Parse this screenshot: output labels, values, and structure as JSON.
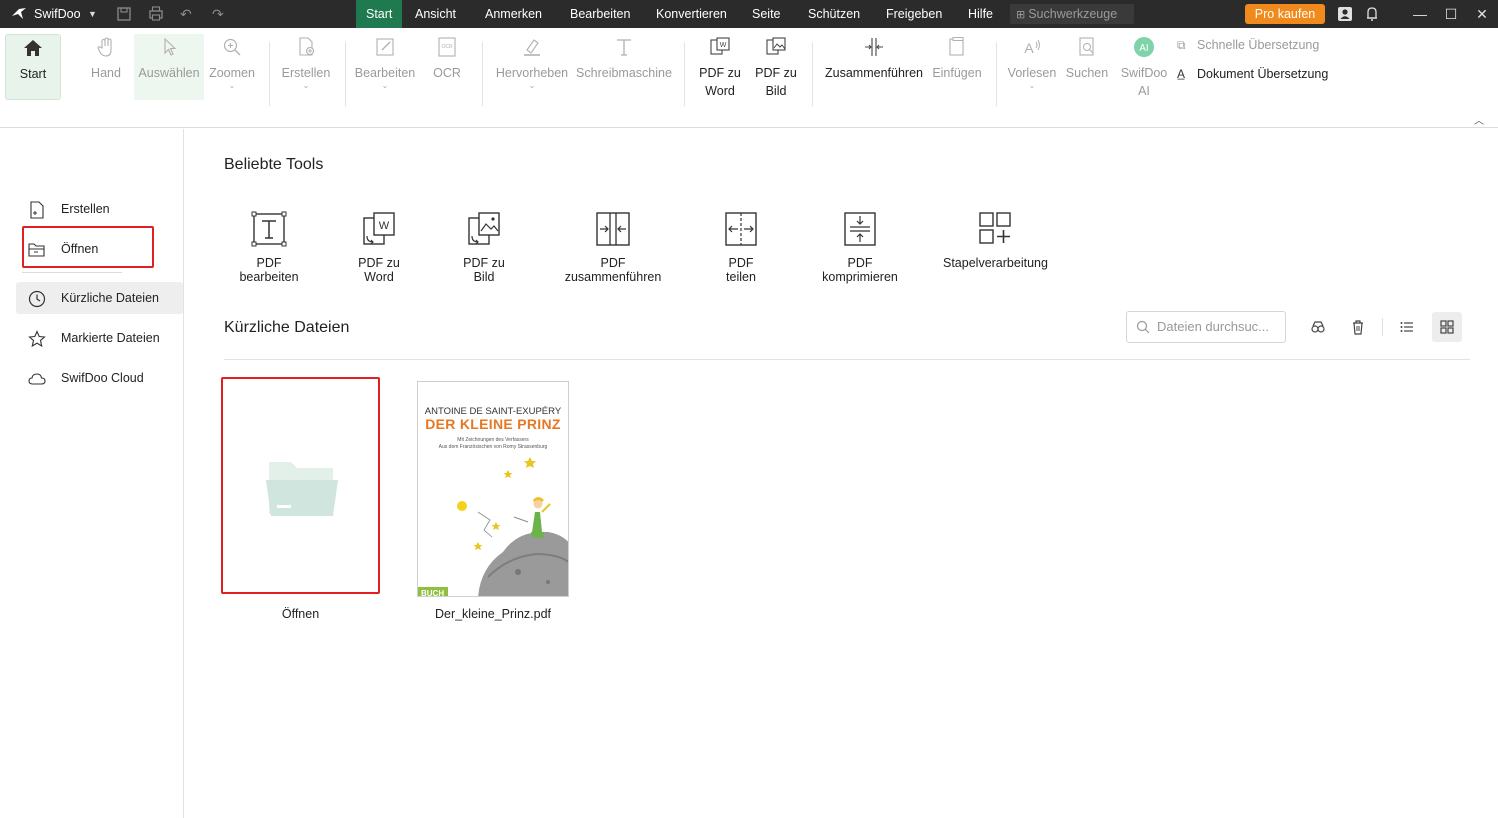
{
  "titlebar": {
    "app_name": "SwifDoo",
    "menu": [
      "Start",
      "Ansicht",
      "Anmerken",
      "Bearbeiten",
      "Konvertieren",
      "Seite",
      "Schützen",
      "Freigeben",
      "Hilfe"
    ],
    "active_menu": "Start",
    "search_placeholder": "Suchwerkzeuge",
    "pro_label": "Pro kaufen"
  },
  "ribbon": {
    "start": "Start",
    "hand": "Hand",
    "select": "Auswählen",
    "zoom": "Zoomen",
    "create": "Erstellen",
    "edit": "Bearbeiten",
    "ocr": "OCR",
    "highlight": "Hervorheben",
    "typewriter": "Schreibmaschine",
    "pdf_to_word_1": "PDF zu",
    "pdf_to_word_2": "Word",
    "pdf_to_image_1": "PDF zu",
    "pdf_to_image_2": "Bild",
    "merge": "Zusammenführen",
    "insert": "Einfügen",
    "read_aloud": "Vorlesen",
    "search": "Suchen",
    "ai_1": "SwifDoo",
    "ai_2": "AI",
    "ai_badge": "AI",
    "quick_translate": "Schnelle Übersetzung",
    "doc_translate": "Dokument Übersetzung"
  },
  "sidebar": {
    "create": "Erstellen",
    "open": "Öffnen",
    "recent": "Kürzliche Dateien",
    "marked": "Markierte Dateien",
    "cloud": "SwifDoo Cloud"
  },
  "popular_tools": {
    "title": "Beliebte Tools",
    "items": [
      "PDF bearbeiten",
      "PDF zu Word",
      "PDF zu Bild",
      "PDF zusammenführen",
      "PDF teilen",
      "PDF komprimieren",
      "Stapelverarbeitung"
    ]
  },
  "recent_files": {
    "title": "Kürzliche Dateien",
    "search_placeholder": "Dateien durchsuc...",
    "open_card_label": "Öffnen",
    "file_name": "Der_kleine_Prinz.pdf",
    "book_author": "ANTOINE DE SAINT-EXUPÉRY",
    "book_title": "DER KLEINE PRINZ",
    "book_sub_1": "Mit Zeichnungen des Verfassers",
    "book_sub_2": "Aus dem Französischen von Romy Strassenburg",
    "book_corner": "BUCH"
  },
  "colors": {
    "accent": "#1f7a4f",
    "pro": "#f08a1c",
    "highlight_box": "#e02020",
    "folder": "#cfe5dd"
  }
}
